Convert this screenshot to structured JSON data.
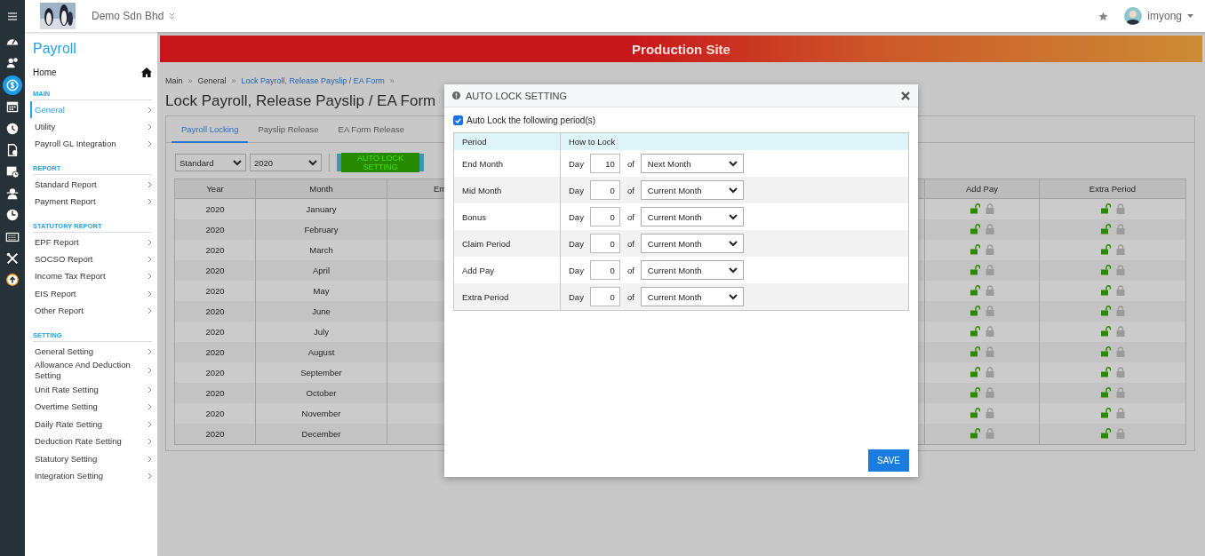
{
  "icon_rail": [
    {
      "selected": false
    },
    {
      "selected": false
    },
    {
      "selected": true
    },
    {
      "selected": false
    },
    {
      "selected": false
    },
    {
      "selected": false
    },
    {
      "selected": false
    },
    {
      "selected": false
    },
    {
      "selected": false
    },
    {
      "selected": false
    },
    {
      "selected": false
    },
    {
      "selected": false
    }
  ],
  "top_bar": {
    "company": "Demo Sdn Bhd",
    "user": "imyong"
  },
  "sidebar": {
    "title": "Payroll",
    "home": "Home",
    "sections": [
      {
        "heading": "MAIN",
        "items": [
          {
            "label": "General",
            "selected": true
          },
          {
            "label": "Utility",
            "selected": false
          },
          {
            "label": "Payroll GL Integration",
            "selected": false
          }
        ]
      },
      {
        "heading": "REPORT",
        "items": [
          {
            "label": "Standard Report",
            "selected": false
          },
          {
            "label": "Payment Report",
            "selected": false
          }
        ]
      },
      {
        "heading": "STATUTORY REPORT",
        "items": [
          {
            "label": "EPF Report",
            "selected": false
          },
          {
            "label": "SOCSO Report",
            "selected": false
          },
          {
            "label": "Income Tax Report",
            "selected": false
          },
          {
            "label": "EIS Report",
            "selected": false
          },
          {
            "label": "Other Report",
            "selected": false
          }
        ]
      },
      {
        "heading": "SETTING",
        "items": [
          {
            "label": "General Setting",
            "selected": false
          },
          {
            "label": "Allowance And Deduction Setting",
            "selected": false
          },
          {
            "label": "Unit Rate Setting",
            "selected": false
          },
          {
            "label": "Overtime Setting",
            "selected": false
          },
          {
            "label": "Daily Rate Setting",
            "selected": false
          },
          {
            "label": "Deduction Rate Setting",
            "selected": false
          },
          {
            "label": "Statutory Setting",
            "selected": false
          },
          {
            "label": "Integration Setting",
            "selected": false
          }
        ]
      }
    ]
  },
  "banner": "Production Site",
  "breadcrumb": {
    "separator": "»",
    "items": [
      {
        "label": "Main",
        "kind": "plain"
      },
      {
        "label": "General",
        "kind": "plain"
      },
      {
        "label": "Lock Payroll, Release Payslip / EA Form",
        "kind": "link"
      }
    ]
  },
  "page_title": "Lock Payroll, Release Payslip / EA Form",
  "tabs": [
    {
      "label": "Payroll Locking",
      "selected": true
    },
    {
      "label": "Payslip Release",
      "selected": false
    },
    {
      "label": "EA Form Release",
      "selected": false
    }
  ],
  "filters": {
    "type": "Standard",
    "year": "2020"
  },
  "auto_lock_button": "AUTO LOCK SETTING",
  "table": {
    "columns": [
      "Year",
      "Month",
      "Em",
      "Add Pay",
      "Extra Period"
    ],
    "rows": [
      {
        "year": "2020",
        "month": "January",
        "add_pay_locked": false,
        "extra_period_locked": false
      },
      {
        "year": "2020",
        "month": "February",
        "add_pay_locked": false,
        "extra_period_locked": false
      },
      {
        "year": "2020",
        "month": "March",
        "add_pay_locked": false,
        "extra_period_locked": false
      },
      {
        "year": "2020",
        "month": "April",
        "add_pay_locked": false,
        "extra_period_locked": false
      },
      {
        "year": "2020",
        "month": "May",
        "add_pay_locked": false,
        "extra_period_locked": false
      },
      {
        "year": "2020",
        "month": "June",
        "add_pay_locked": false,
        "extra_period_locked": false
      },
      {
        "year": "2020",
        "month": "July",
        "add_pay_locked": false,
        "extra_period_locked": false
      },
      {
        "year": "2020",
        "month": "August",
        "add_pay_locked": false,
        "extra_period_locked": false
      },
      {
        "year": "2020",
        "month": "September",
        "add_pay_locked": false,
        "extra_period_locked": false
      },
      {
        "year": "2020",
        "month": "October",
        "add_pay_locked": false,
        "extra_period_locked": false
      },
      {
        "year": "2020",
        "month": "November",
        "add_pay_locked": false,
        "extra_period_locked": false
      },
      {
        "year": "2020",
        "month": "December",
        "add_pay_locked": false,
        "extra_period_locked": false
      }
    ]
  },
  "modal": {
    "title": "AUTO LOCK SETTING",
    "checkbox": {
      "label": "Auto Lock the following period(s)",
      "checked": true
    },
    "columns": [
      "Period",
      "How to Lock"
    ],
    "rows": [
      {
        "period": "End Month",
        "day_label": "Day",
        "day": "10",
        "of_label": "of",
        "month": "Next Month"
      },
      {
        "period": "Mid Month",
        "day_label": "Day",
        "day": "0",
        "of_label": "of",
        "month": "Current Month"
      },
      {
        "period": "Bonus",
        "day_label": "Day",
        "day": "0",
        "of_label": "of",
        "month": "Current Month"
      },
      {
        "period": "Claim Period",
        "day_label": "Day",
        "day": "0",
        "of_label": "of",
        "month": "Current Month"
      },
      {
        "period": "Add Pay",
        "day_label": "Day",
        "day": "0",
        "of_label": "of",
        "month": "Current Month"
      },
      {
        "period": "Extra Period",
        "day_label": "Day",
        "day": "0",
        "of_label": "of",
        "month": "Current Month"
      }
    ],
    "save": "SAVE"
  }
}
